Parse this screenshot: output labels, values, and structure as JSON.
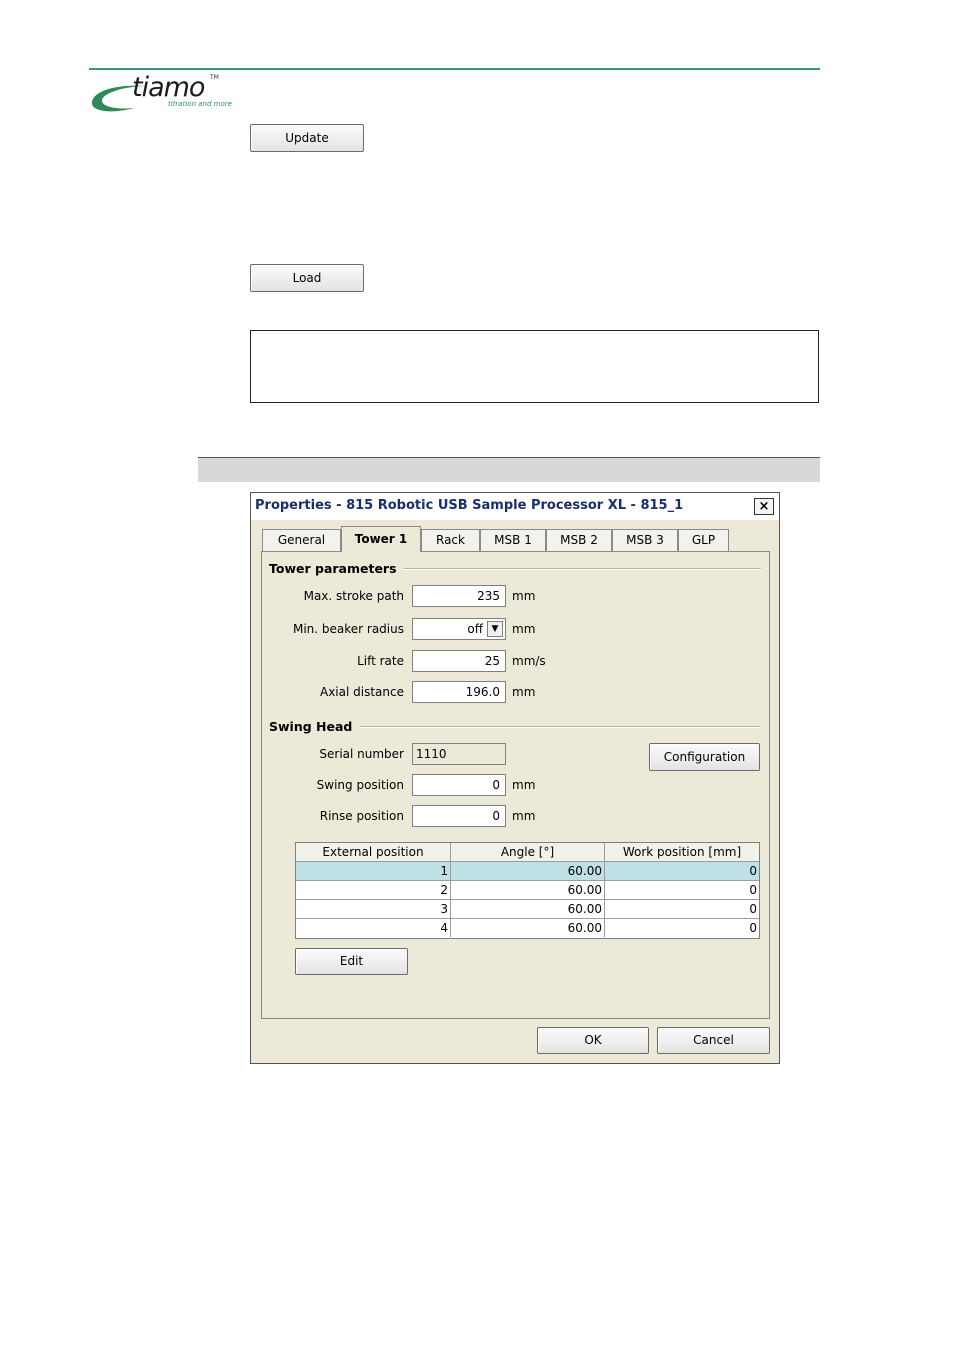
{
  "header": {
    "logo_word": "tiamo",
    "logo_tm": "TM",
    "logo_tagline": "titration and more",
    "accent_color": "#3a9a6e"
  },
  "page": {
    "update_label": "Update",
    "load_label": "Load"
  },
  "dialog": {
    "title": "Properties - 815 Robotic USB Sample Processor XL - 815_1",
    "close_glyph": "×",
    "tabs": [
      "General",
      "Tower 1",
      "Rack",
      "MSB 1",
      "MSB 2",
      "MSB 3",
      "GLP"
    ],
    "active_tab": "Tower 1",
    "tower_parameters": {
      "title": "Tower parameters",
      "max_stroke_label": "Max. stroke path",
      "max_stroke_value": "235",
      "max_stroke_unit": "mm",
      "min_beaker_label": "Min. beaker radius",
      "min_beaker_value": "off",
      "min_beaker_unit": "mm",
      "lift_rate_label": "Lift rate",
      "lift_rate_value": "25",
      "lift_rate_unit": "mm/s",
      "axial_distance_label": "Axial distance",
      "axial_distance_value": "196.0",
      "axial_distance_unit": "mm"
    },
    "swing_head": {
      "title": "Swing Head",
      "serial_label": "Serial number",
      "serial_value": "1110",
      "configuration_label": "Configuration",
      "swing_pos_label": "Swing position",
      "swing_pos_value": "0",
      "swing_pos_unit": "mm",
      "rinse_pos_label": "Rinse position",
      "rinse_pos_value": "0",
      "rinse_pos_unit": "mm"
    },
    "table": {
      "columns": [
        "External position",
        "Angle [°]",
        "Work position [mm]"
      ],
      "rows": [
        [
          "1",
          "60.00",
          "0"
        ],
        [
          "2",
          "60.00",
          "0"
        ],
        [
          "3",
          "60.00",
          "0"
        ],
        [
          "4",
          "60.00",
          "0"
        ]
      ],
      "selected_row": 1,
      "selected_color": "#bfe1e5"
    },
    "edit_label": "Edit",
    "ok_label": "OK",
    "cancel_label": "Cancel"
  }
}
